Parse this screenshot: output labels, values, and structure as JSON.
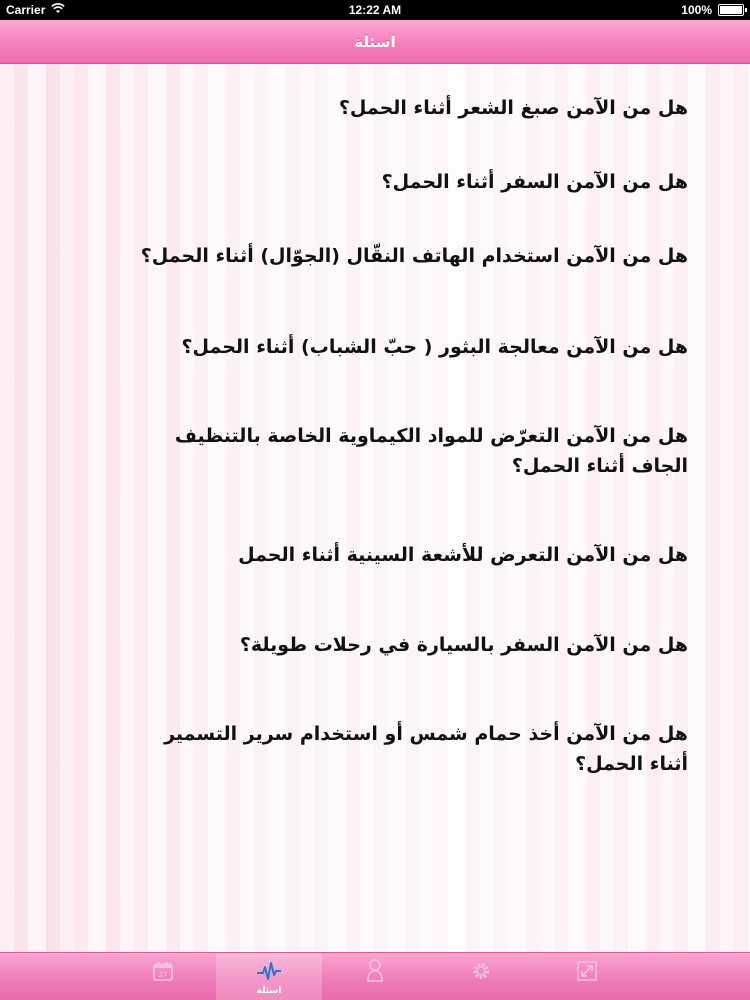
{
  "status_bar": {
    "carrier": "Carrier",
    "time": "12:22 AM",
    "battery": "100%"
  },
  "nav": {
    "title": "اسئلة"
  },
  "questions": [
    "هل من الآمن صبغ الشعر أثناء الحمل؟",
    "هل من الآمن السفر أثناء الحمل؟",
    "هل من الآمن استخدام الهاتف النقّال (الجوّال) أثناء الحمل؟",
    "هل من الآمن معالجة البثور ( حبّ الشباب) أثناء الحمل؟",
    "هل من الآمن التعرّض للمواد الكيماوية الخاصة بالتنظيف الجاف أثناء الحمل؟",
    "هل من الآمن التعرض للأشعة السينية أثناء الحمل",
    "هل من الآمن السفر بالسيارة في رحلات طويلة؟",
    "هل من الآمن أخذ حمام شمس أو استخدام سرير التسمير أثناء الحمل؟"
  ],
  "tabs": [
    {
      "icon": "calendar-icon",
      "label": "",
      "day": "27"
    },
    {
      "icon": "heartbeat-icon",
      "label": "اسئلة"
    },
    {
      "icon": "baby-icon",
      "label": ""
    },
    {
      "icon": "gear-icon",
      "label": ""
    },
    {
      "icon": "expand-icon",
      "label": ""
    }
  ],
  "colors": {
    "nav_pink": "#f57fbc",
    "active_icon": "#2b76c8"
  }
}
